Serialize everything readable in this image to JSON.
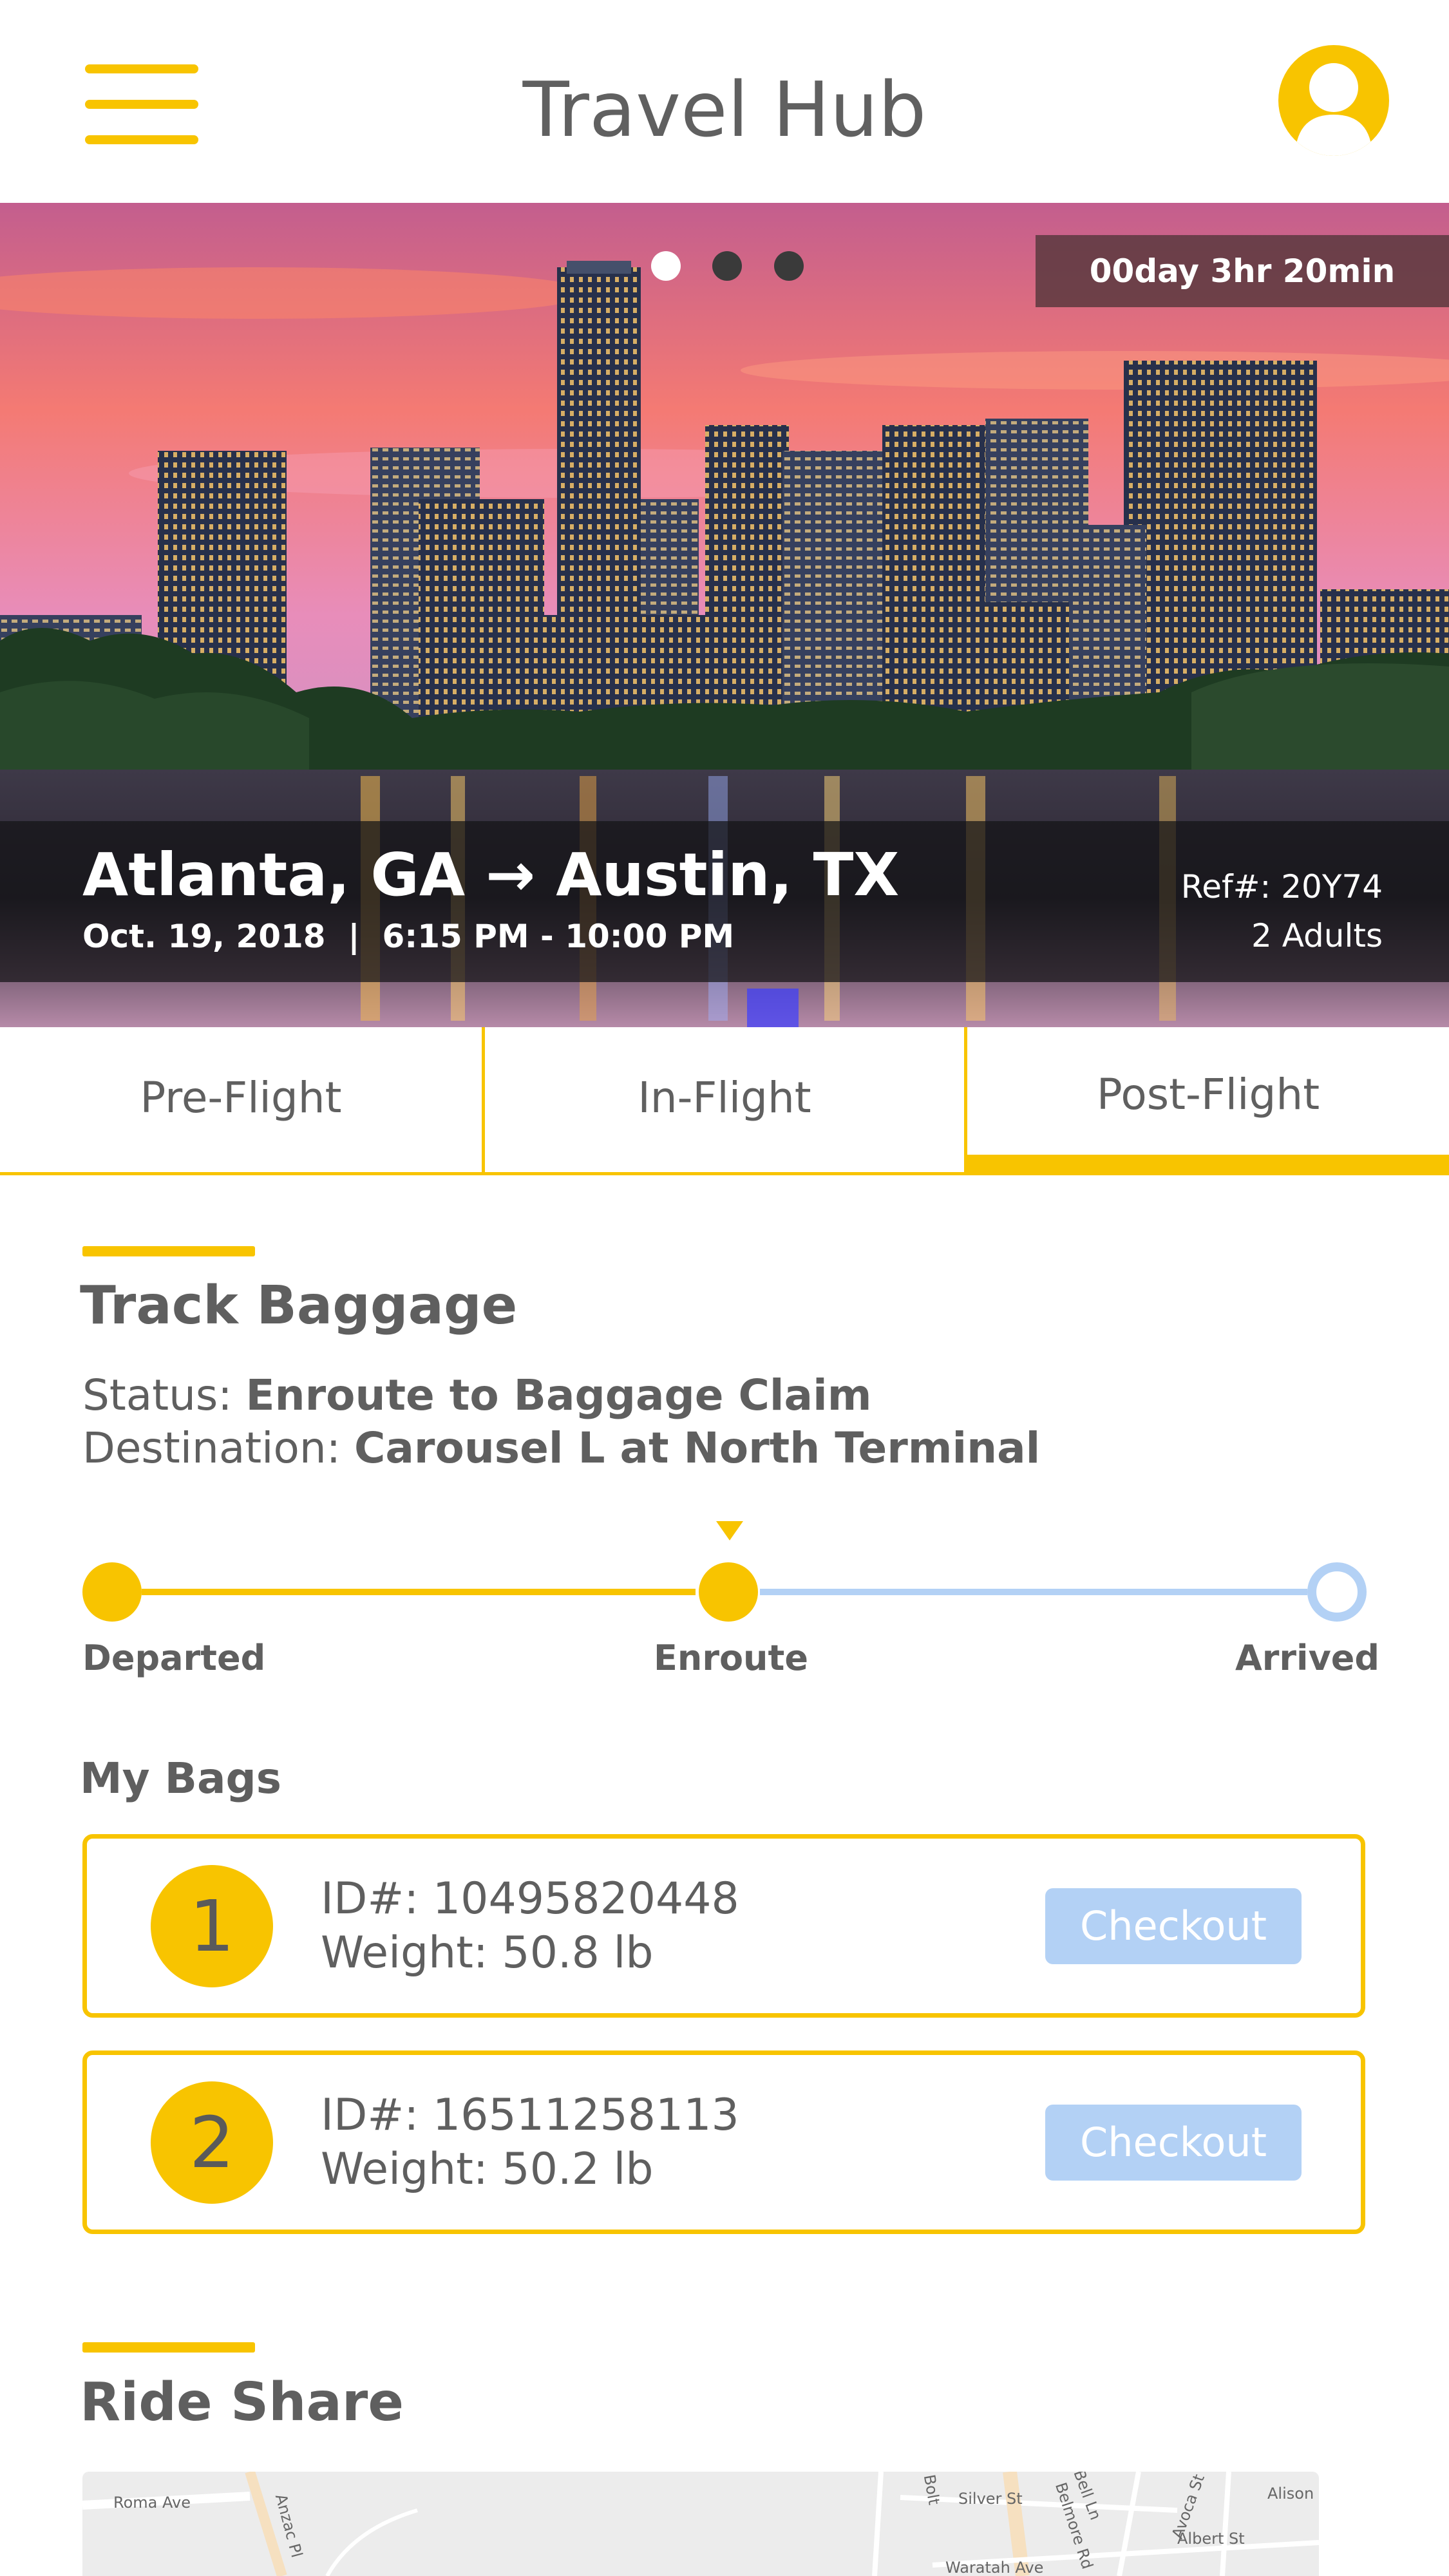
{
  "header": {
    "title": "Travel Hub",
    "menu_icon": "hamburger-menu-icon",
    "avatar_icon": "user-avatar-icon",
    "accent_color": "#f8c400"
  },
  "hero": {
    "image": "Austin city skyline at sunset over the river",
    "countdown": "00day 3hr 20min",
    "carousel": {
      "pages": 3,
      "active_index": 0
    },
    "route": "Atlanta, GA → Austin, TX",
    "datetime": "Oct. 19, 2018  |  6:15 PM - 10:00 PM",
    "ref": "Ref#: 20Y74",
    "passengers": "2 Adults"
  },
  "tabs": {
    "items": [
      {
        "label": "Pre-Flight"
      },
      {
        "label": "In-Flight"
      },
      {
        "label": "Post-Flight"
      }
    ],
    "active": "Post-Flight"
  },
  "track_baggage": {
    "title": "Track Baggage",
    "status_label": "Status:",
    "status_value": "Enroute to Baggage Claim",
    "destination_label": "Destination:",
    "destination_value": "Carousel L at North Terminal",
    "steps": [
      {
        "label": "Departed",
        "state": "done"
      },
      {
        "label": "Enroute",
        "state": "current"
      },
      {
        "label": "Arrived",
        "state": "pending"
      }
    ],
    "progress_color": "#f8c400",
    "pending_color": "#b3d1f5"
  },
  "bags": {
    "title": "My Bags",
    "items": [
      {
        "number": "1",
        "id": "ID#: 10495820448",
        "weight": "Weight: 50.8 lb",
        "button": "Checkout"
      },
      {
        "number": "2",
        "id": "ID#: 16511258113",
        "weight": "Weight: 50.2 lb",
        "button": "Checkout"
      }
    ]
  },
  "ride_share": {
    "title": "Ride Share",
    "map_labels": [
      "Roma Ave",
      "Anzac Pl",
      "Bolt",
      "Silver St",
      "Bell Ln",
      "Belmore Rd",
      "Avoca St",
      "Alison",
      "Albert St",
      "Waratah Ave"
    ]
  }
}
